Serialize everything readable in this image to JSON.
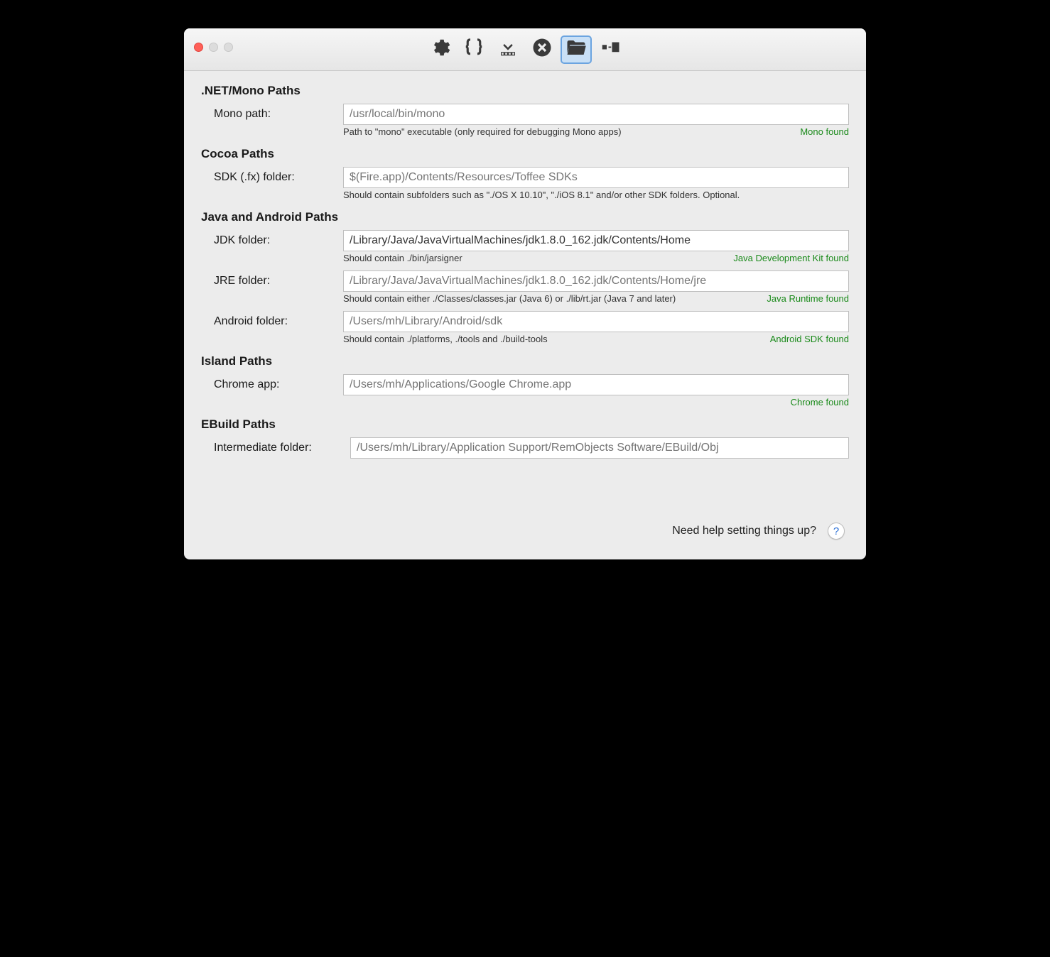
{
  "toolbar": {
    "icons": [
      "gear-icon",
      "braces-icon",
      "download-icon",
      "close-circle-icon",
      "folder-open-icon",
      "scale-icon"
    ],
    "selected_index": 4
  },
  "sections": {
    "net": {
      "title": ".NET/Mono Paths",
      "mono": {
        "label": "Mono path:",
        "placeholder": "/usr/local/bin/mono",
        "value": "",
        "hint": "Path to \"mono\" executable (only required for debugging Mono apps)",
        "status": "Mono found"
      }
    },
    "cocoa": {
      "title": "Cocoa Paths",
      "sdk": {
        "label": "SDK (.fx) folder:",
        "placeholder": "$(Fire.app)/Contents/Resources/Toffee SDKs",
        "value": "",
        "hint": "Should contain subfolders such as \"./OS X 10.10\", \"./iOS 8.1\" and/or other SDK folders. Optional.",
        "status": ""
      }
    },
    "java": {
      "title": "Java and Android Paths",
      "jdk": {
        "label": "JDK folder:",
        "value": "/Library/Java/JavaVirtualMachines/jdk1.8.0_162.jdk/Contents/Home",
        "hint": "Should contain ./bin/jarsigner",
        "status": "Java Development Kit found"
      },
      "jre": {
        "label": "JRE folder:",
        "placeholder": "/Library/Java/JavaVirtualMachines/jdk1.8.0_162.jdk/Contents/Home/jre",
        "value": "",
        "hint": "Should contain either ./Classes/classes.jar (Java 6) or ./lib/rt.jar (Java 7 and later)",
        "status": "Java Runtime found"
      },
      "android": {
        "label": "Android folder:",
        "placeholder": "/Users/mh/Library/Android/sdk",
        "value": "",
        "hint": "Should contain ./platforms, ./tools and ./build-tools",
        "status": "Android SDK found"
      }
    },
    "island": {
      "title": "Island Paths",
      "chrome": {
        "label": "Chrome app:",
        "placeholder": "/Users/mh/Applications/Google Chrome.app",
        "value": "",
        "hint": "",
        "status": "Chrome found"
      }
    },
    "ebuild": {
      "title": "EBuild Paths",
      "intermediate": {
        "label": "Intermediate folder:",
        "placeholder": "/Users/mh/Library/Application Support/RemObjects Software/EBuild/Obj",
        "value": "",
        "hint": "",
        "status": ""
      }
    }
  },
  "footer": {
    "text": "Need help setting things up?",
    "help": "?"
  }
}
